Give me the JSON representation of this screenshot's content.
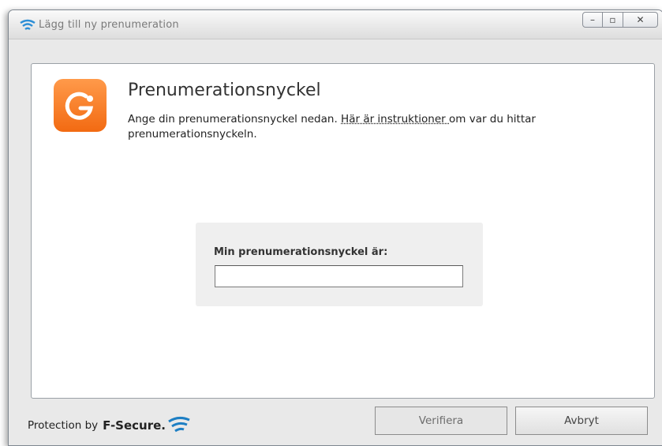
{
  "window": {
    "title": "Lägg till ny prenumeration"
  },
  "title_controls": {
    "minimize_glyph": "–",
    "maximize_glyph": "▫",
    "close_glyph": "✕"
  },
  "content": {
    "heading": "Prenumerationsnyckel",
    "desc_before": "Ange din prenumerationsnyckel nedan. ",
    "desc_link": "Här är instruktioner ",
    "desc_after": " om var du hittar prenumerationsnyckeln.",
    "key_label": "Min prenumerationsnyckel är:",
    "key_value": ""
  },
  "footer": {
    "protection_by": "Protection by",
    "brand": "F-Secure.",
    "verify_label": "Verifiera",
    "cancel_label": "Avbryt"
  },
  "colors": {
    "logo_orange": "#f47a24",
    "brand_blue": "#1e7fc4"
  },
  "icons": {
    "title": "wifi-signal-icon",
    "logo": "f-secure-safe-logo-icon",
    "brand": "f-secure-swoosh-icon"
  }
}
